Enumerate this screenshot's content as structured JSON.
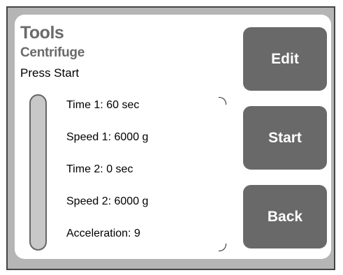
{
  "header": {
    "title": "Tools",
    "subtitle": "Centrifuge"
  },
  "status_text": "Press Start",
  "parameters": [
    "Time 1: 60 sec",
    "Speed 1: 6000 g",
    "Time 2: 0 sec",
    "Speed 2: 6000 g",
    "Acceleration: 9"
  ],
  "buttons": {
    "edit": "Edit",
    "start": "Start",
    "back": "Back"
  },
  "colors": {
    "frame": "#b5b5b5",
    "button": "#696969",
    "heading": "#6a6a6a",
    "scrollbar": "#c8c8c8"
  }
}
